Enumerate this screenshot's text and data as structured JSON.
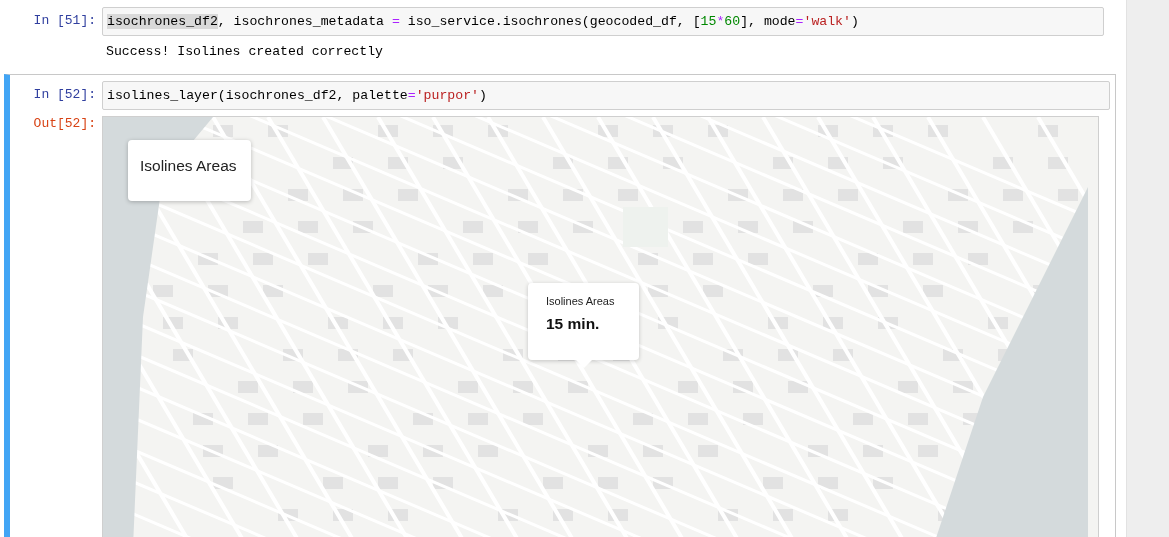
{
  "cells": [
    {
      "prompt": "In [51]:",
      "selected": false,
      "code": [
        {
          "kind": "selection",
          "text": "isochrones_df2"
        },
        {
          "kind": "plain",
          "text": ", isochrones_metadata "
        },
        {
          "kind": "operator",
          "text": "="
        },
        {
          "kind": "plain",
          "text": " iso_service.isochrones(geocoded_df, ["
        },
        {
          "kind": "number",
          "text": "15"
        },
        {
          "kind": "operator",
          "text": "*"
        },
        {
          "kind": "number",
          "text": "60"
        },
        {
          "kind": "plain",
          "text": "], mode"
        },
        {
          "kind": "operator",
          "text": "="
        },
        {
          "kind": "string",
          "text": "'walk'"
        },
        {
          "kind": "plain",
          "text": ")"
        }
      ],
      "output": {
        "kind": "text",
        "text": "Success! Isolines created correctly"
      }
    },
    {
      "prompt": "In [52]:",
      "selected": true,
      "code": [
        {
          "kind": "plain",
          "text": "isolines_layer(isochrones_df2, palette"
        },
        {
          "kind": "operator",
          "text": "="
        },
        {
          "kind": "string",
          "text": "'purpor'"
        },
        {
          "kind": "plain",
          "text": ")"
        }
      ],
      "output": {
        "kind": "map",
        "prompt": "Out[52]:",
        "legend": {
          "title": "Isolines Areas"
        },
        "tooltip": {
          "title": "Isolines Areas",
          "value": "15 min."
        }
      }
    }
  ]
}
